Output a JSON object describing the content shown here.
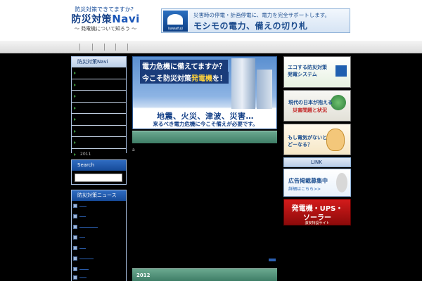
{
  "header": {
    "tagline": "防災対策できてますか？",
    "title": "防災対策",
    "title_suffix": "Navi",
    "subtitle": "〜 発電機について知ろう 〜"
  },
  "top_banner": {
    "brand": "kawafuji",
    "line1": "災害時の停電・計画停電に、電力を完全サポートします。",
    "line2": "モシモの電力、備えの切り札"
  },
  "sidebar": {
    "navi_heading": "防災対策Navi",
    "navi_items": [
      "",
      "",
      "",
      "",
      "",
      "",
      "",
      "2011"
    ],
    "search_heading": "Search",
    "news_heading": "防災対策ニュース"
  },
  "hero": {
    "line1": "電力危機に備えてますか？",
    "line2_pre": "今こそ防災対策",
    "line2_hl": "発電機",
    "line2_post": "を！",
    "disaster": "地震、火災、津波、災害…",
    "call": "来るべき電力危機に今こそ備えが必要です。"
  },
  "main": {
    "dot": "a",
    "year_label": "2012"
  },
  "right_banners": {
    "eco_l1": "エコする防災対策",
    "eco_l2": "発電システム",
    "disaster_l1": "現代の日本が抱える",
    "disaster_l2": "災害問題と状況",
    "no_power_l1": "もし電気がないと",
    "no_power_l2": "どーなる？",
    "link_heading": "LINK",
    "ad_l1": "広告掲載募集中",
    "ad_l2": "詳細はこちら>>",
    "ups_l1": "発電機・UPS・",
    "ups_l2": "ソーラー",
    "ups_l3": "激安特設サイト"
  }
}
